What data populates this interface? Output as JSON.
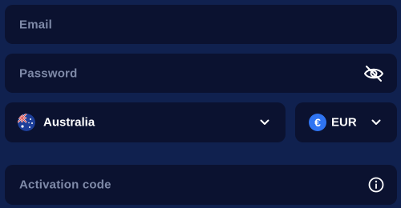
{
  "colors": {
    "page_background": "#10214f",
    "field_background": "#0b1230",
    "placeholder_text": "#7f8aa8",
    "value_text": "#ffffff",
    "currency_accent": "#2f74f2"
  },
  "form": {
    "email": {
      "placeholder": "Email",
      "value": ""
    },
    "password": {
      "placeholder": "Password",
      "value": "",
      "toggle_icon": "eye-slash-icon"
    },
    "country": {
      "selected": "Australia",
      "flag_icon": "australia-flag-icon",
      "dropdown_icon": "chevron-down-icon"
    },
    "currency": {
      "selected": "EUR",
      "symbol": "€",
      "dropdown_icon": "chevron-down-icon"
    },
    "activation_code": {
      "placeholder": "Activation code",
      "value": "",
      "info_icon": "info-icon"
    }
  }
}
